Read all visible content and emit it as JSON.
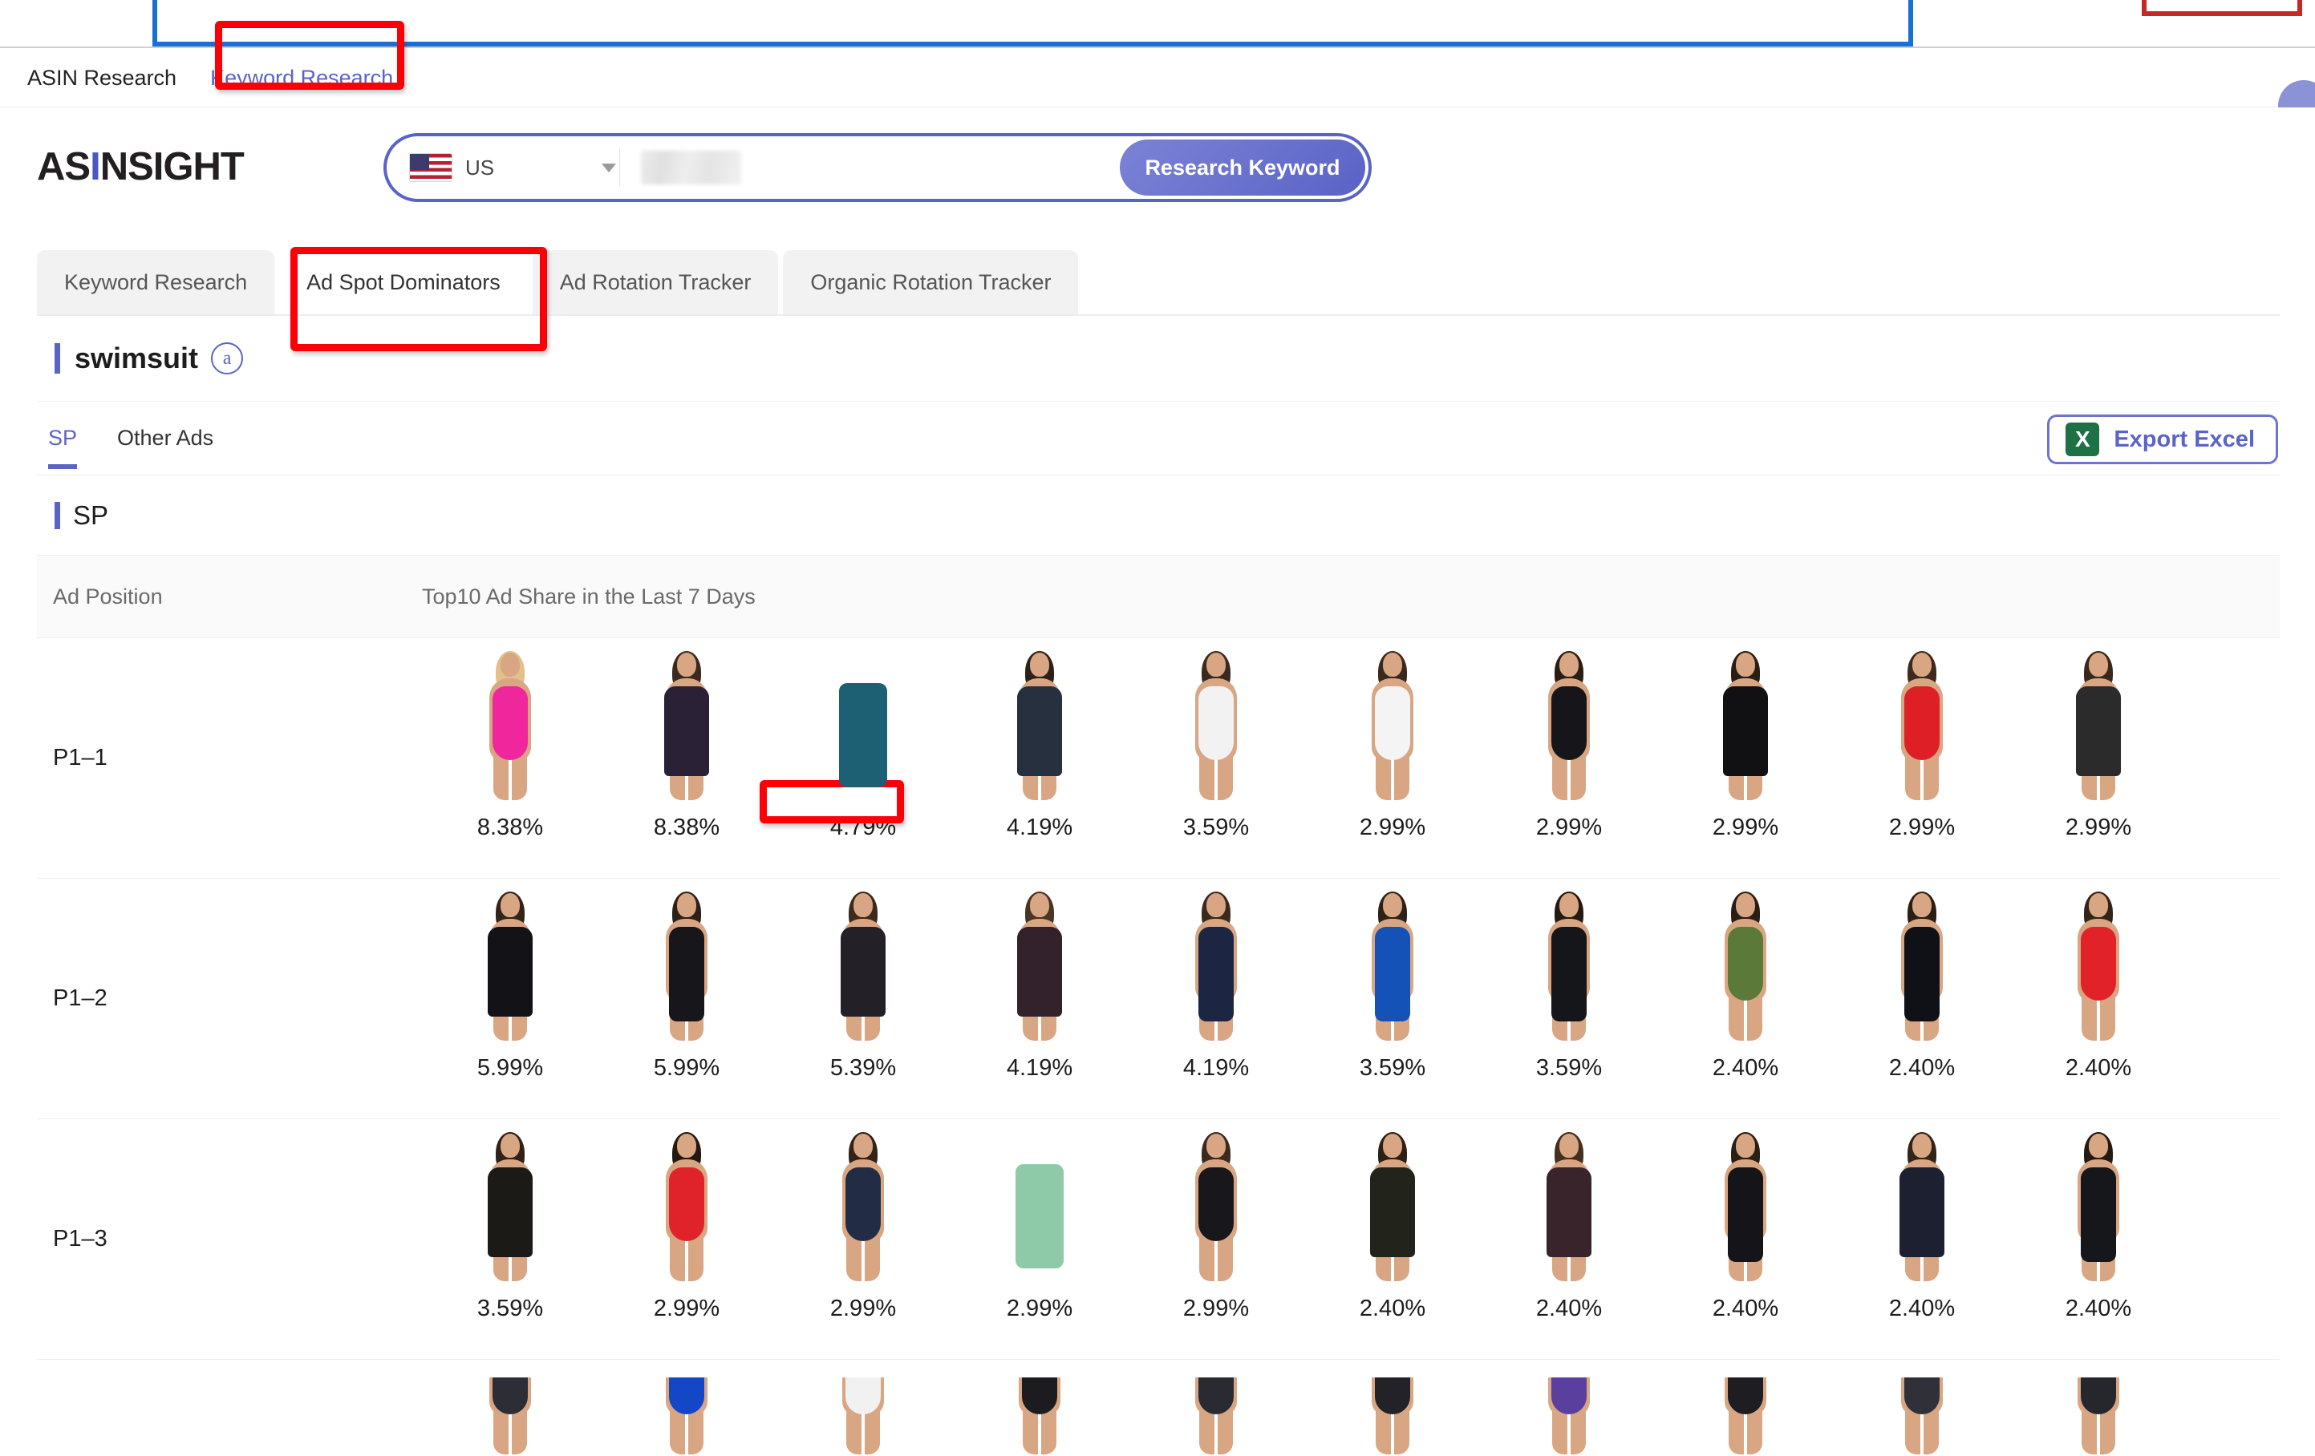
{
  "browser": {
    "tab_outline": "highlighted-tab",
    "close_mark": "red-corner-mark"
  },
  "appnav": {
    "items": [
      {
        "label": "ASIN Research",
        "active": false
      },
      {
        "label": "Keyword Research",
        "active": true
      }
    ],
    "avatar": "user-avatar"
  },
  "brand": {
    "name_left": "AS",
    "name_mid": "I",
    "name_right": "NSIGHT",
    "full": "ASINSIGHT"
  },
  "search": {
    "marketplace": "US",
    "marketplace_flag": "us-flag-icon",
    "dropdown_icon": "chevron-down-icon",
    "keyword_value": "",
    "keyword_redacted": true,
    "button_label": "Research Keyword"
  },
  "subtabs": [
    {
      "label": "Keyword Research",
      "active": false
    },
    {
      "label": "Ad Spot Dominators",
      "active": true
    },
    {
      "label": "Ad Rotation Tracker",
      "active": false
    },
    {
      "label": "Organic Rotation Tracker",
      "active": false
    }
  ],
  "keyword_card": {
    "keyword": "swimsuit",
    "badge": "a",
    "badge_name": "amazon-badge-icon"
  },
  "adtabs": [
    {
      "label": "SP",
      "active": true
    },
    {
      "label": "Other Ads",
      "active": false
    }
  ],
  "export": {
    "icon_label": "X",
    "label": "Export Excel"
  },
  "sp_section": {
    "title": "SP"
  },
  "table": {
    "headers": {
      "position": "Ad Position",
      "share": "Top10 Ad Share in the Last 7 Days"
    },
    "rows": [
      {
        "position": "P1–1",
        "cells": [
          {
            "share": "8.38%",
            "product": "pink-bikini",
            "suit": "#f0269c",
            "suit_class": "suit",
            "hair": "#e3c08a"
          },
          {
            "share": "8.38%",
            "product": "floral-swimdress",
            "suit": "#2b2136",
            "suit_class": "suit dress",
            "hair": "#3a2a1e"
          },
          {
            "share": "4.79%",
            "product": "teal-swim-pants",
            "suit": "#1d5f73",
            "suit_class": "suit shorts",
            "hair": "none",
            "highlighted": true
          },
          {
            "share": "4.19%",
            "product": "tropical-tankini",
            "suit": "#27303f",
            "suit_class": "suit dress",
            "hair": "#2e2118"
          },
          {
            "share": "3.59%",
            "product": "white-onepiece",
            "suit": "#f2f2f2",
            "suit_class": "suit",
            "hair": "#3a2a1e"
          },
          {
            "share": "2.99%",
            "product": "white-mesh-onepiece",
            "suit": "#f4f4f4",
            "suit_class": "suit",
            "hair": "#3a2a1e"
          },
          {
            "share": "2.99%",
            "product": "black-cutout-suit",
            "suit": "#16161a",
            "suit_class": "suit",
            "hair": "#2a1d14"
          },
          {
            "share": "2.99%",
            "product": "black-swimdress",
            "suit": "#111114",
            "suit_class": "suit dress",
            "hair": "#2a1d14"
          },
          {
            "share": "2.99%",
            "product": "red-bandeau-suit",
            "suit": "#de2026",
            "suit_class": "suit",
            "hair": "#3d2a1c"
          },
          {
            "share": "2.99%",
            "product": "bw-print-swimdress",
            "suit": "#2b2b2b",
            "suit_class": "suit dress",
            "hair": "#38271b"
          }
        ]
      },
      {
        "position": "P1–2",
        "cells": [
          {
            "share": "5.99%",
            "product": "black-swimdress-v",
            "suit": "#131317",
            "suit_class": "suit dress",
            "hair": "#33241a"
          },
          {
            "share": "5.99%",
            "product": "black-boyleg-suit",
            "suit": "#16161b",
            "suit_class": "suit longer",
            "hair": "#2e2017"
          },
          {
            "share": "5.39%",
            "product": "floral-tankini-black",
            "suit": "#242027",
            "suit_class": "suit dress",
            "hair": "#3b2a1d"
          },
          {
            "share": "4.19%",
            "product": "pink-floral-romper",
            "suit": "#33222b",
            "suit_class": "suit dress",
            "hair": "#4a3424"
          },
          {
            "share": "4.19%",
            "product": "navy-athletic-suit",
            "suit": "#1c2541",
            "suit_class": "suit longer",
            "hair": "#3a2a1e"
          },
          {
            "share": "3.59%",
            "product": "blue-print-race-suit",
            "suit": "#1452b8",
            "suit_class": "suit longer",
            "hair": "#2f2117"
          },
          {
            "share": "3.59%",
            "product": "black-green-race-suit",
            "suit": "#15161a",
            "suit_class": "suit longer",
            "hair": "#241a12"
          },
          {
            "share": "2.40%",
            "product": "couple-beachwear",
            "suit": "#5b7a3a",
            "suit_class": "suit",
            "hair": "#2a1d14"
          },
          {
            "share": "2.40%",
            "product": "black-boyshort-suit",
            "suit": "#101116",
            "suit_class": "suit longer",
            "hair": "#2b1e15"
          },
          {
            "share": "2.40%",
            "product": "red-ruched-onepiece",
            "suit": "#e12229",
            "suit_class": "suit",
            "hair": "#33241a"
          }
        ]
      },
      {
        "position": "P1–3",
        "cells": [
          {
            "share": "3.59%",
            "product": "black-gold-floral-dress",
            "suit": "#1c1a16",
            "suit_class": "suit dress",
            "hair": "#2f2117"
          },
          {
            "share": "2.99%",
            "product": "red-plunge-onepiece",
            "suit": "#e0232a",
            "suit_class": "suit",
            "hair": "#241912"
          },
          {
            "share": "2.99%",
            "product": "navy-print-onepiece",
            "suit": "#232c45",
            "suit_class": "suit",
            "hair": "#31231a"
          },
          {
            "share": "2.99%",
            "product": "tropical-rash-guard",
            "suit": "#8ec9a8",
            "suit_class": "suit shorts",
            "hair": "none"
          },
          {
            "share": "2.99%",
            "product": "black-ruched-onepiece",
            "suit": "#18181c",
            "suit_class": "suit",
            "hair": "#3b2a1d"
          },
          {
            "share": "2.40%",
            "product": "dark-floral-swimdress",
            "suit": "#22241c",
            "suit_class": "suit dress",
            "hair": "#2e2017"
          },
          {
            "share": "2.40%",
            "product": "pink-floral-swimdress",
            "suit": "#39242c",
            "suit_class": "suit dress",
            "hair": "#44301f"
          },
          {
            "share": "2.40%",
            "product": "black-pink-trim-boyleg",
            "suit": "#141419",
            "suit_class": "suit longer",
            "hair": "#2b1e15"
          },
          {
            "share": "2.40%",
            "product": "dot-print-swimdress",
            "suit": "#1d2030",
            "suit_class": "suit dress",
            "hair": "#33241a"
          },
          {
            "share": "2.40%",
            "product": "black-teal-race-suit",
            "suit": "#15171a",
            "suit_class": "suit longer",
            "hair": "#241a12"
          }
        ]
      },
      {
        "position": "",
        "partial": true,
        "cells": [
          {
            "share": "",
            "product": "partial-thumb-1",
            "suit": "#2d2d35",
            "suit_class": "suit",
            "hair": "#3a2a1e"
          },
          {
            "share": "",
            "product": "partial-thumb-2",
            "suit": "#1446c8",
            "suit_class": "suit",
            "hair": "#201710"
          },
          {
            "share": "",
            "product": "partial-thumb-3",
            "suit": "#f1f1f1",
            "suit_class": "suit",
            "hair": "#2f2117"
          },
          {
            "share": "",
            "product": "partial-thumb-4",
            "suit": "#1c1c20",
            "suit_class": "suit",
            "hair": "#3b2a1d"
          },
          {
            "share": "",
            "product": "partial-thumb-5",
            "suit": "#2a2a33",
            "suit_class": "suit",
            "hair": "#33241a"
          },
          {
            "share": "",
            "product": "partial-thumb-6",
            "suit": "#222228",
            "suit_class": "suit",
            "hair": "#2b1e15"
          },
          {
            "share": "",
            "product": "partial-thumb-7",
            "suit": "#5b3f9e",
            "suit_class": "suit",
            "hair": "#2f2117"
          },
          {
            "share": "",
            "product": "partial-thumb-8",
            "suit": "#1d1d22",
            "suit_class": "suit",
            "hair": "#241a12"
          },
          {
            "share": "",
            "product": "partial-thumb-9",
            "suit": "#303038",
            "suit_class": "suit",
            "hair": "#3a2a1e"
          },
          {
            "share": "",
            "product": "partial-thumb-10",
            "suit": "#26262d",
            "suit_class": "suit",
            "hair": "#33241a"
          }
        ]
      }
    ]
  },
  "annotations": [
    {
      "name": "keyword-research-highlight",
      "color": "#fb0007"
    },
    {
      "name": "ad-spot-dominators-highlight",
      "color": "#fb0007"
    },
    {
      "name": "share-value-highlight",
      "color": "#fb0007"
    }
  ],
  "colors": {
    "accent": "#5a63c6",
    "annotation": "#fb0007",
    "excel_green": "#1e7145",
    "tab_blue": "#1a6fd4"
  }
}
